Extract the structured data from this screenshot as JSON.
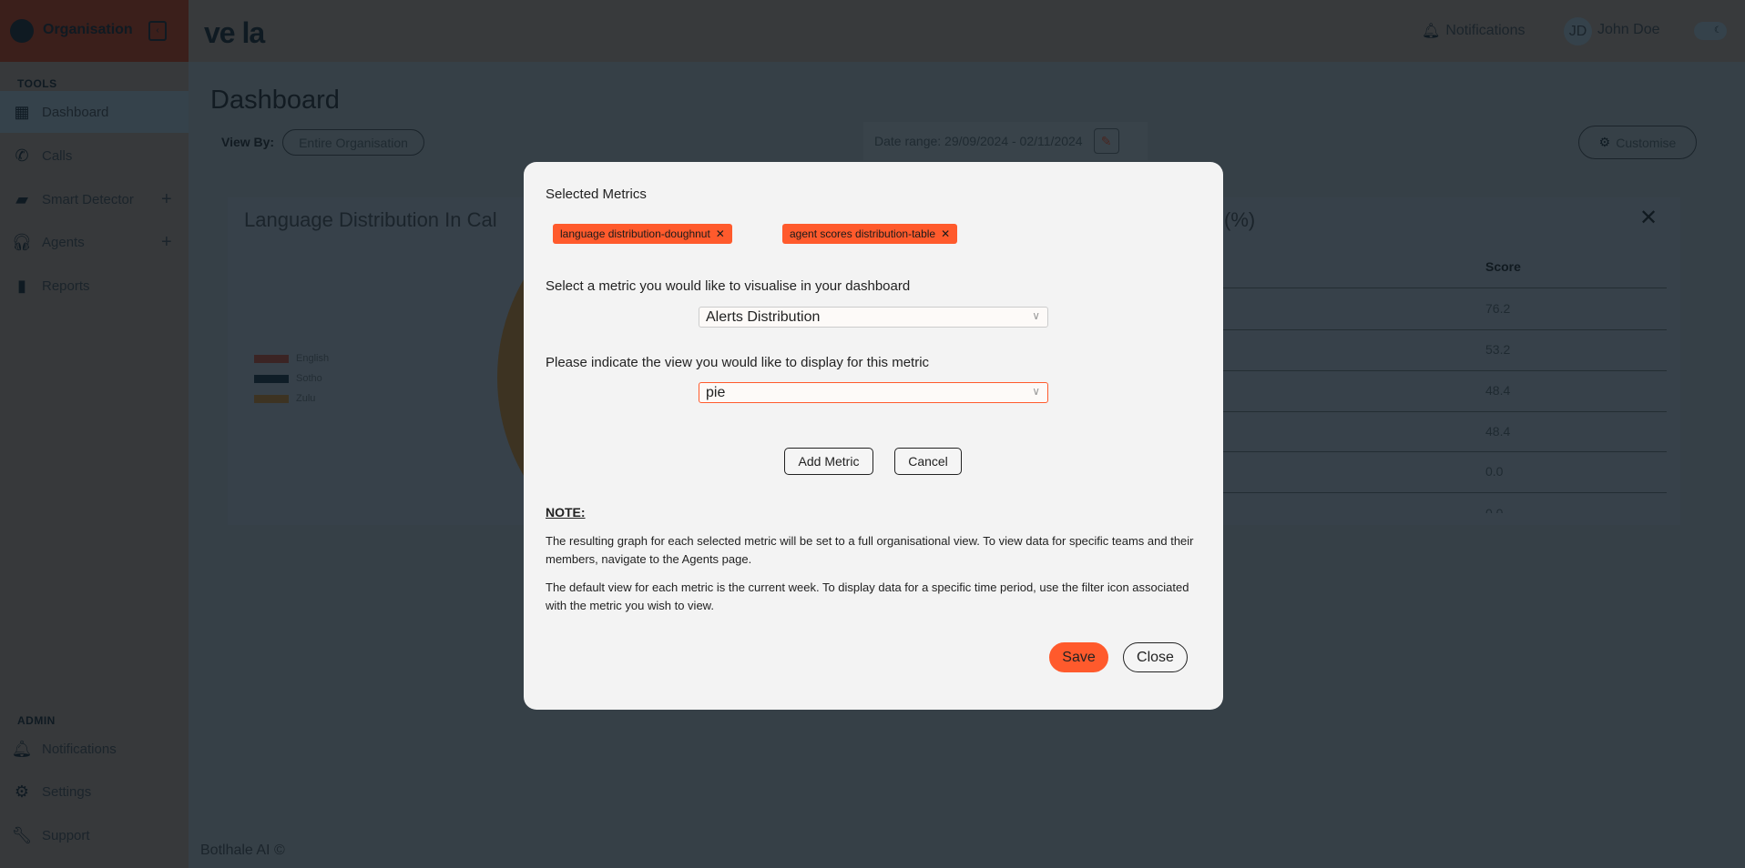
{
  "sidebar": {
    "org": "Organisation",
    "tools_label": "TOOLS",
    "admin_label": "ADMIN",
    "items": [
      {
        "label": "Dashboard",
        "icon": "dashboard-icon"
      },
      {
        "label": "Calls",
        "icon": "phone-icon"
      },
      {
        "label": "Smart Detector",
        "icon": "chat-check-icon"
      },
      {
        "label": "Agents",
        "icon": "headset-icon"
      },
      {
        "label": "Reports",
        "icon": "report-icon"
      }
    ],
    "admin_items": [
      {
        "label": "Notifications",
        "icon": "bell-icon"
      },
      {
        "label": "Settings",
        "icon": "gear-icon"
      },
      {
        "label": "Support",
        "icon": "wrench-icon"
      }
    ]
  },
  "header": {
    "logo": "ve la",
    "notifications": "Notifications",
    "avatar": "JD",
    "user": "John Doe"
  },
  "page": {
    "title": "Dashboard",
    "view_by_label": "View By:",
    "view_by_value": "Entire Organisation",
    "date_range": "Date range: 29/09/2024 - 02/11/2024",
    "customise": "Customise",
    "footer": "Botlhale AI ©"
  },
  "card_language": {
    "title": "Language Distribution In Cal",
    "legend": [
      {
        "label": "English",
        "color": "#3b2424"
      },
      {
        "label": "Sotho",
        "color": "#0f1d27"
      },
      {
        "label": "Zulu",
        "color": "#3d3322"
      }
    ]
  },
  "card_scores": {
    "title_suffix": "(%)",
    "column": "Score",
    "values": [
      "76.2",
      "53.2",
      "48.4",
      "48.4",
      "0.0",
      "0.0"
    ]
  },
  "modal": {
    "selected_title": "Selected Metrics",
    "chips": [
      "language distribution-doughnut",
      "agent scores distribution-table"
    ],
    "metric_label": "Select a metric you would like to visualise in your dashboard",
    "metric_value": "Alerts Distribution",
    "view_label": "Please indicate the view you would like to display for this metric",
    "view_value": "pie",
    "add_metric": "Add Metric",
    "cancel": "Cancel",
    "note_title": "NOTE:",
    "note_1": "The resulting graph for each selected metric will be set to a full organisational view. To view data for specific teams and their members, navigate to the Agents page.",
    "note_2": "The default view for each metric is the current week. To display data for a specific time period, use the filter icon associated with the metric you wish to view.",
    "save": "Save",
    "close": "Close",
    "accent": "#ff5a2c"
  }
}
